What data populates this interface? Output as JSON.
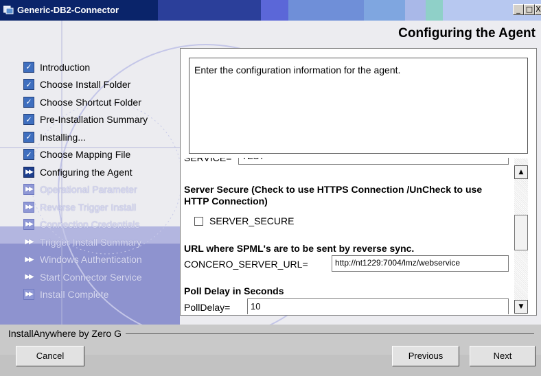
{
  "window": {
    "title": "Generic-DB2-Connector",
    "minimize_glyph": "_",
    "maximize_glyph": "□",
    "close_glyph": "X"
  },
  "header": {
    "title": "Configuring the Agent"
  },
  "steps": [
    {
      "label": "Introduction",
      "state": "done",
      "icon": "check-icon"
    },
    {
      "label": "Choose Install Folder",
      "state": "done",
      "icon": "check-icon"
    },
    {
      "label": "Choose Shortcut Folder",
      "state": "done",
      "icon": "check-icon"
    },
    {
      "label": "Pre-Installation Summary",
      "state": "done",
      "icon": "check-icon"
    },
    {
      "label": "Installing...",
      "state": "done",
      "icon": "check-icon"
    },
    {
      "label": "Choose Mapping File",
      "state": "done",
      "icon": "check-icon"
    },
    {
      "label": "Configuring the Agent",
      "state": "current",
      "icon": "double-arrow-icon"
    },
    {
      "label": "Operational Parameter",
      "state": "pending",
      "icon": "double-arrow-icon"
    },
    {
      "label": "Reverse Trigger Install",
      "state": "pending",
      "icon": "double-arrow-icon"
    },
    {
      "label": "Connection Credentials",
      "state": "pending",
      "icon": "double-arrow-icon"
    },
    {
      "label": "Trigger Install Summary",
      "state": "pending",
      "icon": "double-arrow-icon"
    },
    {
      "label": "Windows Authentication",
      "state": "pending",
      "icon": "double-arrow-icon"
    },
    {
      "label": "Start Connector Service",
      "state": "pending",
      "icon": "double-arrow-icon"
    },
    {
      "label": "Install Complete",
      "state": "pending",
      "icon": "double-arrow-icon"
    }
  ],
  "description": "Enter the configuration information for the agent.",
  "form": {
    "service_label": "SERVICE=",
    "service_value": "TEST",
    "server_secure_heading": "Server Secure (Check to use HTTPS Connection /UnCheck to use HTTP Connection)",
    "server_secure_checkbox_label": "SERVER_SECURE",
    "server_secure_checked": false,
    "url_heading": "URL where SPML's are to be sent by reverse sync.",
    "url_label": "CONCERO_SERVER_URL=",
    "url_value": "http://nt1229:7004/lmz/webservice",
    "poll_heading": "Poll Delay in Seconds",
    "poll_label": "PollDelay=",
    "poll_value": "10"
  },
  "scrollbar": {
    "up_glyph": "▲",
    "down_glyph": "▼"
  },
  "footer": {
    "brand": "InstallAnywhere by Zero G",
    "cancel_label": "Cancel",
    "previous_label": "Previous",
    "next_label": "Next"
  },
  "colors": {
    "titlebar": "#0a246a",
    "step_done": "#000000",
    "step_pending": "#d8d9f1",
    "check_icon": "#3f6fbf"
  }
}
